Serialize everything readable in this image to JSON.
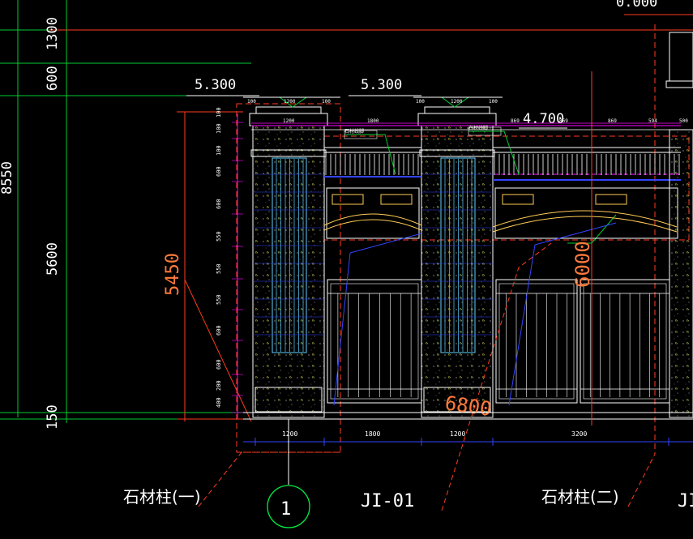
{
  "overall_dims": {
    "left_total": "8550",
    "left_top": "1300",
    "left_mid": "600",
    "left_main": "5600",
    "left_bottom": "150",
    "top_right": "0.000"
  },
  "elevations": {
    "left": "5.300",
    "center": "5.300",
    "right": "4.700",
    "height_dim": "5450"
  },
  "cap_dims": {
    "c1": "100",
    "c2": "1200",
    "c3": "100",
    "c4": "100",
    "c5": "1200",
    "c6": "100"
  },
  "top_dims": [
    "1200",
    "1800",
    "869",
    "869",
    "869",
    "594",
    "500"
  ],
  "vertical_dims": [
    "100",
    "100",
    "100",
    "600",
    "600",
    "550",
    "550",
    "550",
    "600",
    "600",
    "200",
    "400"
  ],
  "bottom_dims": [
    "1200",
    "1800",
    "1200",
    "3200"
  ],
  "callouts": {
    "c6000": "6000",
    "c6800": "6800"
  },
  "labels": {
    "stone_pillar_1": "石材柱(一)",
    "stone_pillar_2": "石材柱(二)",
    "jl01": "JI-01",
    "jl_partial": "JI",
    "axis": "1"
  },
  "notes": {
    "n1": "石材线脚",
    "n2": "石材线脚"
  },
  "colors": {
    "bg": "#000000",
    "dim_green": "#00ff00",
    "dim_red": "#ff3b1f",
    "cyan": "#00e5ff",
    "magenta": "#ff00ff",
    "yellow": "#ffff00",
    "blue": "#3344ff",
    "orange": "#ff7a3c",
    "white": "#ffffff"
  }
}
